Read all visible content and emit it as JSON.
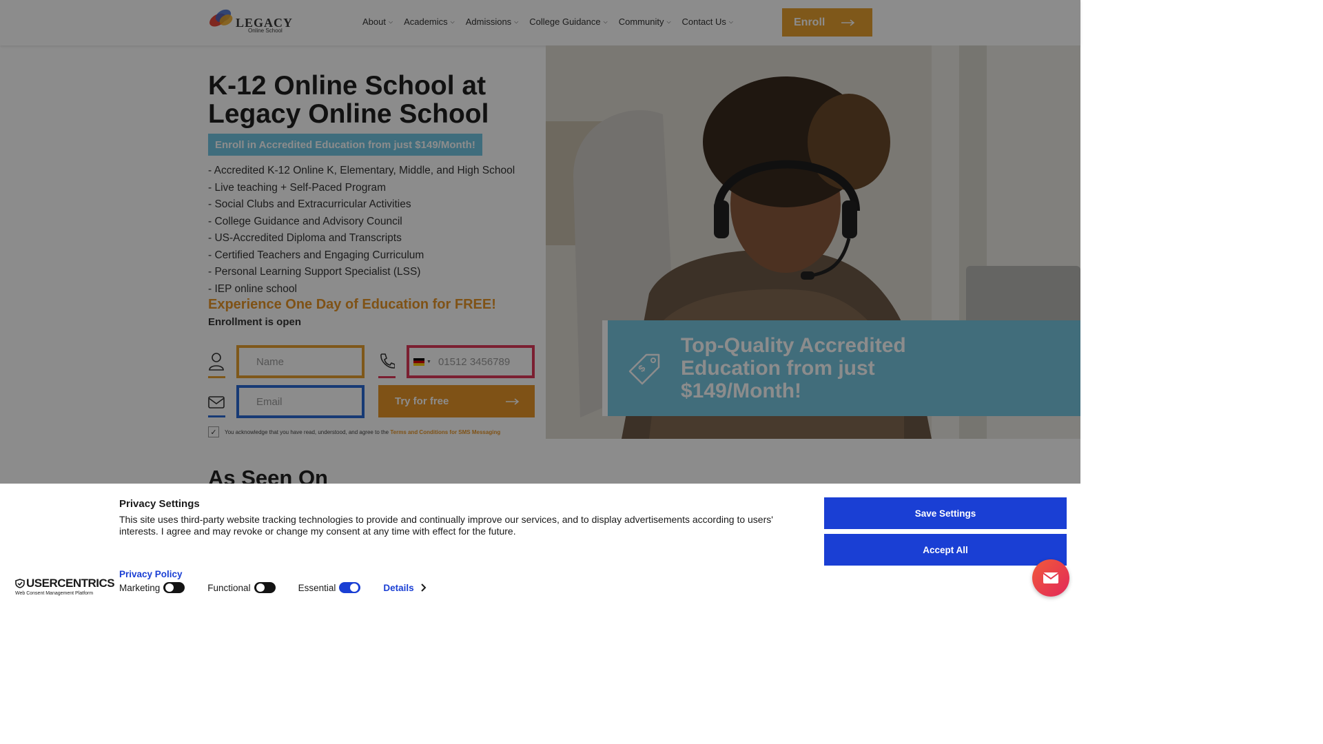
{
  "header": {
    "logo_text": "LEGACY",
    "logo_sub": "Online School",
    "nav": [
      {
        "label": "About"
      },
      {
        "label": "Academics"
      },
      {
        "label": "Admissions"
      },
      {
        "label": "College Guidance"
      },
      {
        "label": "Community"
      },
      {
        "label": "Contact Us"
      }
    ],
    "enroll_label": "Enroll"
  },
  "hero": {
    "title": "K-12 Online School at Legacy Online School",
    "badge": "Enroll in Accredited Education from just $149/Month!",
    "features": [
      "- Accredited K-12 Online K, Elementary, Middle, and High School",
      "- Live teaching + Self-Paced Program",
      "- Social Clubs and Extracurricular Activities",
      "- College Guidance and Advisory Council",
      "- US-Accredited Diploma and Transcripts",
      "- Certified Teachers and Engaging Curriculum",
      "- Personal Learning Support Specialist (LSS)",
      "- IEP online school"
    ],
    "free_line": "Experience One Day of Education for FREE!",
    "open_line": "Enrollment is open"
  },
  "form": {
    "name_placeholder": "Name",
    "phone_placeholder": "01512 3456789",
    "email_placeholder": "Email",
    "submit_label": "Try for free",
    "consent_text": "You acknowledge that you have read, understood, and agree to the",
    "consent_link": "Terms and Conditions for SMS Messaging"
  },
  "promo": {
    "text": "Top-Quality Accredited Education from just $149/Month!"
  },
  "section": {
    "as_seen_on": "As Seen On"
  },
  "consent_banner": {
    "title": "Privacy Settings",
    "text": "This site uses third-party website tracking technologies to provide and continually improve our services, and to display advertisements according to users' interests. I agree and may revoke or change my consent at any time with effect for the future.",
    "policy_link": "Privacy Policy",
    "brand": "USERCENTRICS",
    "brand_sub": "Web Consent Management Platform",
    "toggles": [
      {
        "label": "Marketing",
        "on": false
      },
      {
        "label": "Functional",
        "on": false
      },
      {
        "label": "Essential",
        "on": true
      }
    ],
    "details_label": "Details",
    "save_label": "Save Settings",
    "accept_label": "Accept All"
  },
  "colors": {
    "accent_orange": "#e89628",
    "accent_blue": "#77c6e0",
    "consent_blue": "#1a3fd4",
    "name_border": "#e8a030",
    "phone_border": "#e03a5a",
    "email_border": "#2a6bd6"
  },
  "icons": {
    "user": "user-icon",
    "phone": "phone-icon",
    "mail": "mail-icon",
    "price_tag": "price-tag-icon",
    "arrow": "arrow-right-icon",
    "chevron": "chevron-down-icon"
  }
}
